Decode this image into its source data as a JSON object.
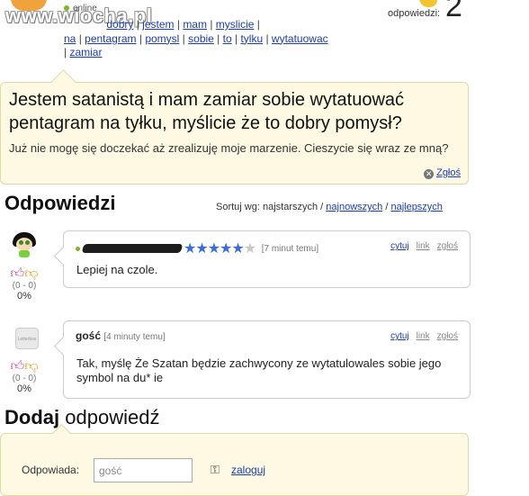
{
  "header": {
    "watermark": "www.wiocha.pl",
    "status": "online",
    "tags": [
      [
        "dobry",
        "jestem",
        "mam",
        "myslicie"
      ],
      [
        "na",
        "pentagram",
        "pomysl",
        "sobie",
        "to",
        "tylku",
        "wytatuowac"
      ],
      [
        "zamiar"
      ]
    ],
    "responses_label": "odpowiedzi:",
    "responses_count": "2"
  },
  "question": {
    "title": "Jestem satanistą i mam zamiar sobie wytatuować pentagram na tyłku, myślicie że to dobry pomysł?",
    "body": "Już nie mogę się doczekać aż zrealizuję moje marzenie. Cieszycie się wraz ze mną?",
    "report_label": "Zgłoś"
  },
  "answers_section": {
    "title": "Odpowiedzi",
    "sort_prefix": "Sortuj wg: najstarszych /",
    "sort_newest": "najnowszych",
    "sort_sep": "/",
    "sort_best": "najlepszych"
  },
  "answers": [
    {
      "time": "[7 minut temu]",
      "stars_filled": "★★★★★",
      "stars_empty": "★",
      "text": "Lepiej na czole.",
      "votes": "(0 - 0)",
      "percent": "0%",
      "actions": {
        "quote": "cytuj",
        "link": "link",
        "report": "zgłoś"
      }
    },
    {
      "user": "gość",
      "time": "[4 minuty temu]",
      "text": "Tak, myślę Że Szatan będzie zachwycony ze wytatulowales sobie jego symbol na du* ie",
      "votes": "(0 - 0)",
      "percent": "0%",
      "avatar_text": "Letterbox",
      "actions": {
        "quote": "cytuj",
        "link": "link",
        "report": "zgłoś"
      }
    }
  ],
  "add_answer": {
    "title_bold": "Dodaj",
    "title_rest": "odpowiedź",
    "label": "Odpowiada:",
    "input_placeholder": "gość",
    "login": "zaloguj"
  },
  "colors": {
    "link": "#1a3cb4",
    "box_bg": "#fdf9e3",
    "online": "#7cb526",
    "stars": "#3b6fd8"
  }
}
